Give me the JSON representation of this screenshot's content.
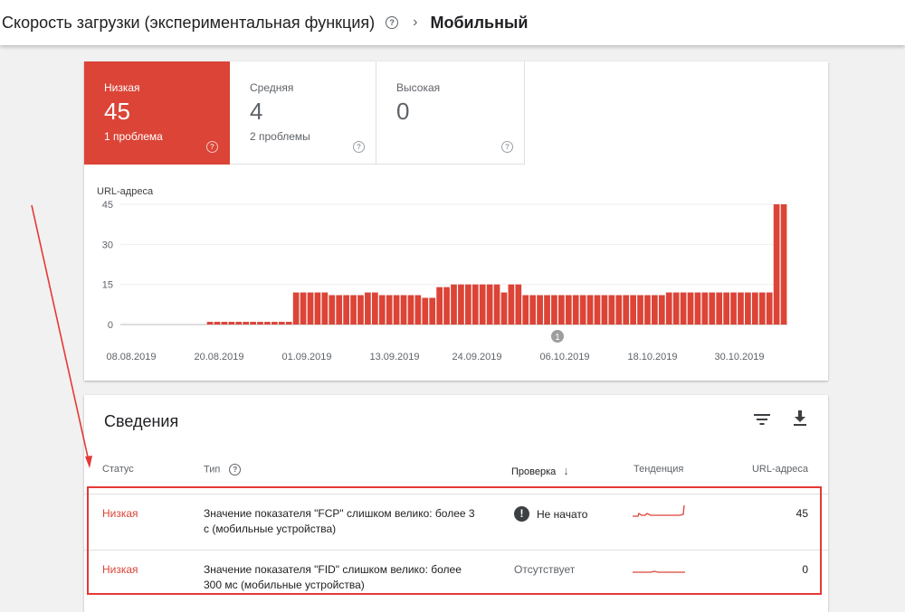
{
  "header": {
    "title": "Скорость загрузки (экспериментальная функция)",
    "help_icon": "help-circle-icon",
    "separator_icon": "chevron-right-icon",
    "current": "Мобильный"
  },
  "summary_tiles": [
    {
      "label": "Низкая",
      "value": "45",
      "sub": "1 проблема",
      "active": true,
      "color": "#db4437"
    },
    {
      "label": "Средняя",
      "value": "4",
      "sub": "2 проблемы",
      "active": false
    },
    {
      "label": "Высокая",
      "value": "0",
      "sub": "",
      "active": false
    }
  ],
  "chart_data": {
    "type": "bar",
    "ylabel": "URL-адреса",
    "yticks": [
      0,
      15,
      30,
      45
    ],
    "ylim": [
      0,
      45
    ],
    "bar_color": "#db4437",
    "xtick_labels": [
      "08.08.2019",
      "20.08.2019",
      "01.09.2019",
      "13.09.2019",
      "24.09.2019",
      "06.10.2019",
      "18.10.2019",
      "30.10.2019"
    ],
    "annotation": "1",
    "values": [
      0,
      0,
      0,
      0,
      0,
      0,
      0,
      0,
      0,
      0,
      0,
      0,
      1,
      1,
      1,
      1,
      1,
      1,
      1,
      1,
      1,
      1,
      1,
      1,
      12,
      12,
      12,
      12,
      12,
      11,
      11,
      11,
      11,
      11,
      12,
      12,
      11,
      11,
      11,
      11,
      11,
      11,
      10,
      10,
      14,
      14,
      15,
      15,
      15,
      15,
      15,
      15,
      15,
      12,
      15,
      15,
      11,
      11,
      11,
      11,
      11,
      11,
      11,
      11,
      11,
      11,
      11,
      11,
      11,
      11,
      11,
      11,
      11,
      11,
      11,
      11,
      12,
      12,
      12,
      12,
      12,
      12,
      12,
      12,
      12,
      12,
      12,
      12,
      12,
      12,
      12,
      45,
      45
    ]
  },
  "details": {
    "title": "Сведения",
    "filter_icon": "filter-icon",
    "download_icon": "download-icon",
    "columns": {
      "status": "Статус",
      "type": "Тип",
      "check": "Проверка",
      "trend": "Тенденция",
      "urls": "URL-адреса"
    },
    "rows": [
      {
        "status": "Низкая",
        "type": "Значение показателя \"FCP\" слишком велико: более 3 с (мобильные устройства)",
        "check": "Не начато",
        "check_icon": "warning-icon",
        "urls": "45"
      },
      {
        "status": "Низкая",
        "type": "Значение показателя \"FID\" слишком велико: более 300 мс (мобильные устройства)",
        "check": "Отсутствует",
        "urls": "0"
      }
    ]
  }
}
